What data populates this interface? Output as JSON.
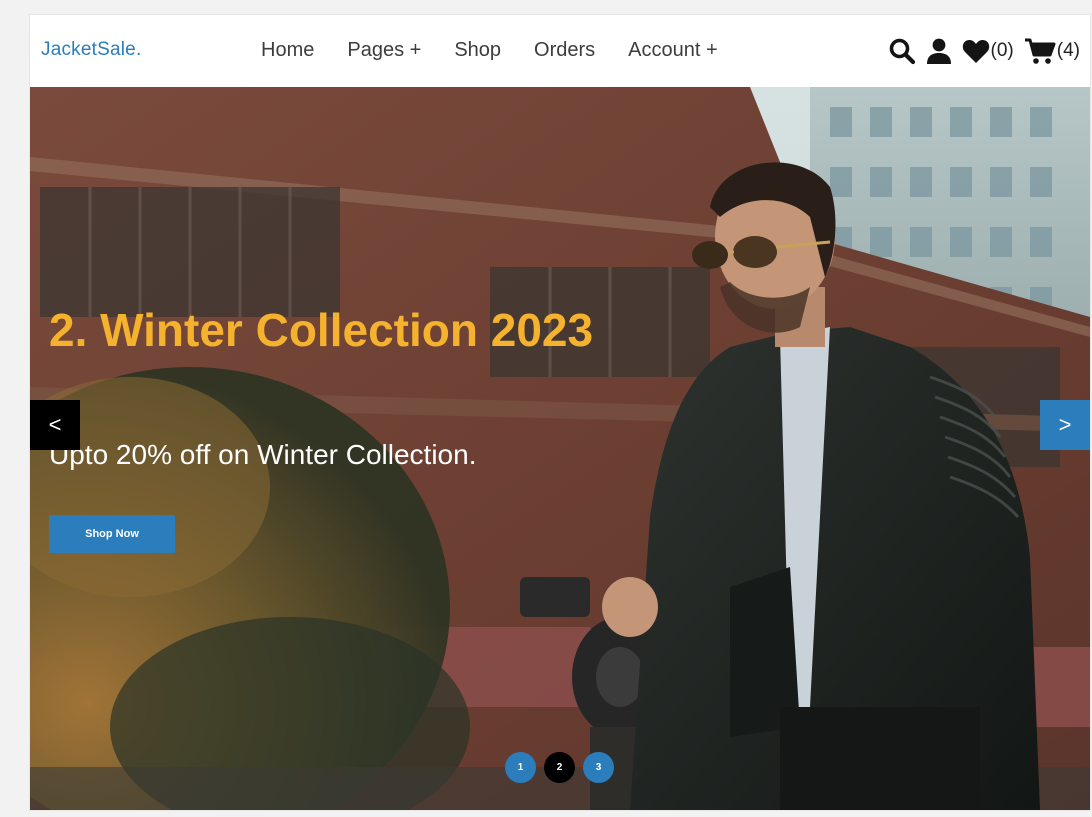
{
  "header": {
    "brand": "JacketSale.",
    "nav": [
      "Home",
      "Pages +",
      "Shop",
      "Orders",
      "Account +"
    ],
    "wishlist_count": "(0)",
    "cart_count": "(4)",
    "icons": [
      "search-icon",
      "user-icon",
      "heart-icon",
      "cart-icon"
    ]
  },
  "hero": {
    "title": "2. Winter Collection 2023",
    "subtitle": "Upto 20% off on Winter Collection.",
    "cta": "Shop Now",
    "prev_arrow": "<",
    "next_arrow": ">",
    "dots": [
      "1",
      "2",
      "3"
    ],
    "active_dot": 2
  },
  "colors": {
    "brand": "#2b7dbc",
    "title": "#f4b22e",
    "prev_arrow_bg": "#000000",
    "next_arrow_bg": "#2b7dbc"
  }
}
